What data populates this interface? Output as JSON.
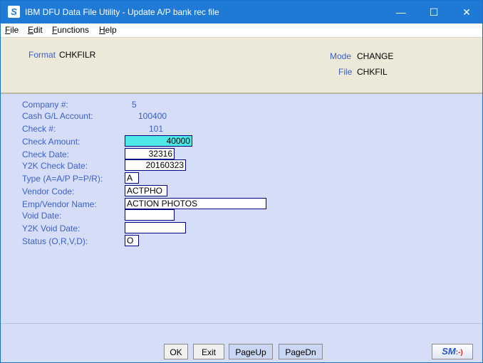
{
  "window": {
    "title": "IBM DFU Data File Utility - Update A/P bank rec file",
    "icon": "S",
    "minimize": "—",
    "maximize": "☐",
    "close": "✕"
  },
  "menu": {
    "file": "File",
    "file_key": "F",
    "file_rest": "ile",
    "edit": "Edit",
    "edit_key": "E",
    "edit_rest": "dit",
    "functions": "Functions",
    "functions_key": "F",
    "functions_rest": "unctions",
    "help": "Help",
    "help_key": "H",
    "help_rest": "elp"
  },
  "header": {
    "format_label": "Format",
    "format_value": "CHKFILR",
    "mode_label": "Mode",
    "mode_value": "CHANGE",
    "file_label": "File",
    "file_value": "CHKFIL"
  },
  "form": {
    "company_label": "Company #:",
    "company_value": "5",
    "cash_gl_label": "Cash G/L Account:",
    "cash_gl_value": "100400",
    "check_no_label": "Check #:",
    "check_no_value": "101",
    "check_amount_label": "Check Amount:",
    "check_amount_value": "40000",
    "check_date_label": "Check Date:",
    "check_date_value": "32316",
    "y2k_check_date_label": "Y2K Check Date:",
    "y2k_check_date_value": "20160323",
    "type_label": "Type (A=A/P P=P/R):",
    "type_value": "A",
    "vendor_code_label": "Vendor Code:",
    "vendor_code_value": "ACTPHO",
    "emp_vendor_name_label": "Emp/Vendor Name:",
    "emp_vendor_name_value": "ACTION PHOTOS",
    "void_date_label": "Void Date:",
    "void_date_value": "",
    "y2k_void_date_label": "Y2K Void Date:",
    "y2k_void_date_value": "",
    "status_label": "Status (O,R,V,D):",
    "status_value": "O"
  },
  "footer": {
    "ok": "OK",
    "exit": "Exit",
    "pageup": "PageUp",
    "pagedn": "PageDn",
    "badge_sm": "SM",
    "badge_face": ":-)"
  },
  "colors": {
    "titlebar": "#1f7ad6",
    "label_blue": "#3b5fc8",
    "form_bg": "#d6def7",
    "header_bg": "#ece9d8",
    "highlight_field": "#4fe8e8"
  }
}
